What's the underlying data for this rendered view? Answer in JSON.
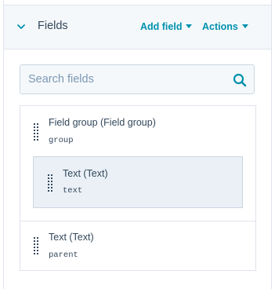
{
  "header": {
    "title": "Fields",
    "add_field_label": "Add field",
    "actions_label": "Actions",
    "collapse_icon": "chevron-down-icon"
  },
  "search": {
    "placeholder": "Search fields",
    "value": "",
    "icon": "search-icon"
  },
  "fields": [
    {
      "label": "Field group (Field group)",
      "name": "group",
      "children": [
        {
          "label": "Text (Text)",
          "name": "text"
        }
      ]
    },
    {
      "label": "Text (Text)",
      "name": "parent"
    }
  ],
  "colors": {
    "accent": "#0091ae",
    "text": "#33475b",
    "placeholder": "#7c98b6",
    "header_bg": "#f5f8fa",
    "nested_bg": "#eaf0f6",
    "border": "#dfe3eb"
  }
}
